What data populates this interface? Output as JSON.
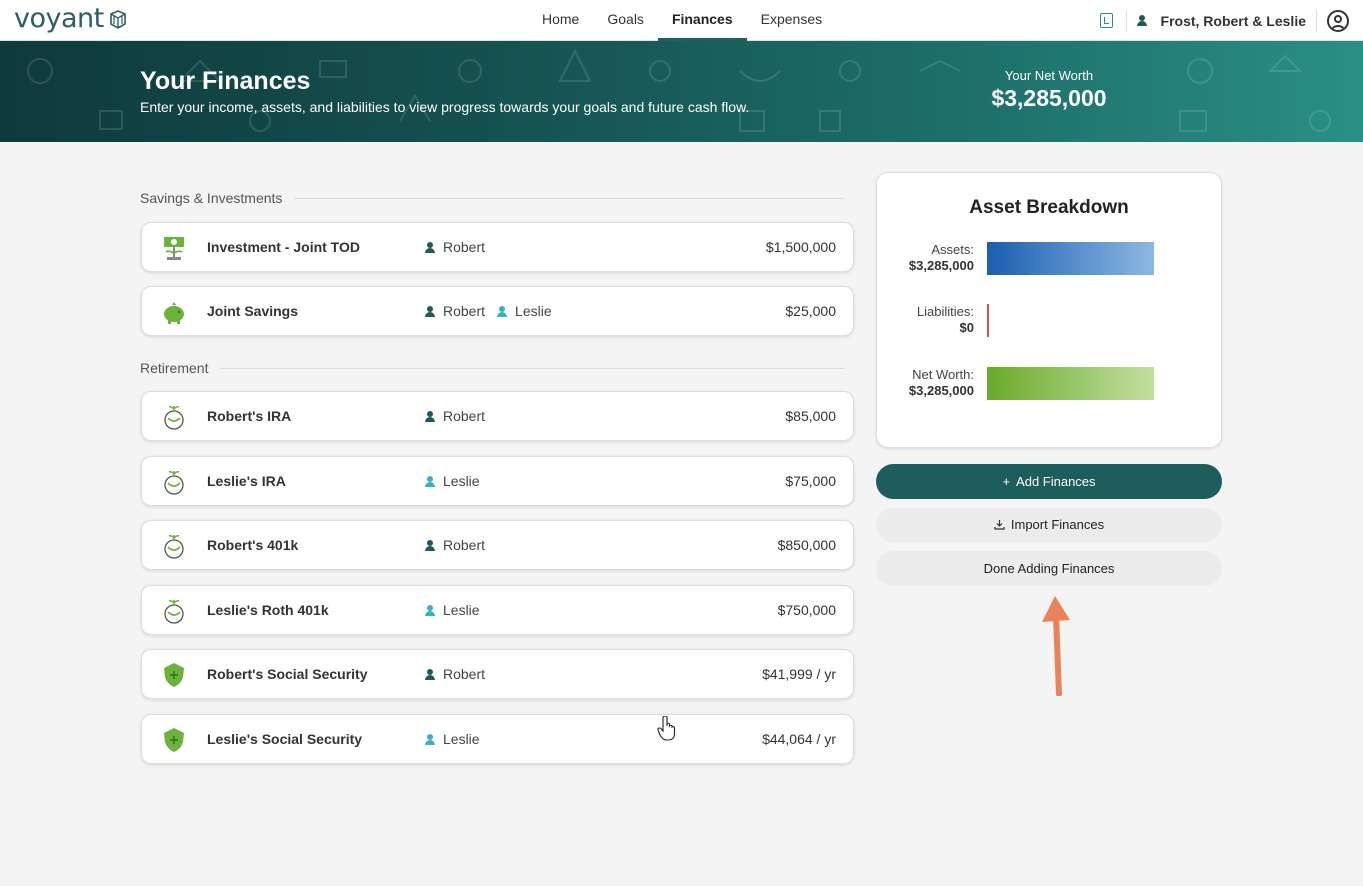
{
  "app": {
    "logo_text": "voyant",
    "nav": [
      "Home",
      "Goals",
      "Finances",
      "Expenses"
    ],
    "active_tab": "Finances",
    "user_name": "Frost, Robert & Leslie"
  },
  "hero": {
    "title": "Your Finances",
    "subtitle": "Enter your income, assets, and liabilities to view progress towards your goals and future cash flow.",
    "networth_label": "Your Net Worth",
    "networth_value": "$3,285,000"
  },
  "sections": {
    "savings": {
      "title": "Savings & Investments",
      "items": [
        {
          "name": "Investment - Joint TOD",
          "owners": [
            "Robert"
          ],
          "value": "$1,500,000",
          "icon": "money-plant-icon"
        },
        {
          "name": "Joint Savings",
          "owners": [
            "Robert",
            "Leslie"
          ],
          "value": "$25,000",
          "icon": "piggy-bank-icon"
        }
      ]
    },
    "retirement": {
      "title": "Retirement",
      "items": [
        {
          "name": "Robert's IRA",
          "owners": [
            "Robert"
          ],
          "value": "$85,000",
          "icon": "nest-egg-icon"
        },
        {
          "name": "Leslie's IRA",
          "owners": [
            "Leslie"
          ],
          "value": "$75,000",
          "icon": "nest-egg-icon"
        },
        {
          "name": "Robert's 401k",
          "owners": [
            "Robert"
          ],
          "value": "$850,000",
          "icon": "nest-egg-icon"
        },
        {
          "name": "Leslie's Roth 401k",
          "owners": [
            "Leslie"
          ],
          "value": "$750,000",
          "icon": "nest-egg-icon"
        },
        {
          "name": "Robert's Social Security",
          "owners": [
            "Robert"
          ],
          "value": "$41,999 / yr",
          "icon": "shield-plus-icon"
        },
        {
          "name": "Leslie's Social Security",
          "owners": [
            "Leslie"
          ],
          "value": "$44,064 / yr",
          "icon": "shield-plus-icon"
        }
      ]
    }
  },
  "breakdown": {
    "title": "Asset Breakdown",
    "assets_label": "Assets:",
    "assets_value": "$3,285,000",
    "liabilities_label": "Liabilities:",
    "liabilities_value": "$0",
    "networth_label": "Net Worth:",
    "networth_value": "$3,285,000",
    "assets_fraction": 1.0,
    "liabilities_fraction": 0.0,
    "networth_fraction": 1.0
  },
  "buttons": {
    "add": "Add Finances",
    "import": "Import Finances",
    "done": "Done Adding Finances"
  },
  "colors": {
    "accent": "#1d5e5c",
    "robert": "#1f5a5a",
    "leslie": "#36b3bf",
    "assets_bar": "#1a5fb0",
    "liabilities_bar": "#c2546a",
    "networth_bar": "#6aaa2a",
    "annotation_arrow": "#e8845c"
  }
}
